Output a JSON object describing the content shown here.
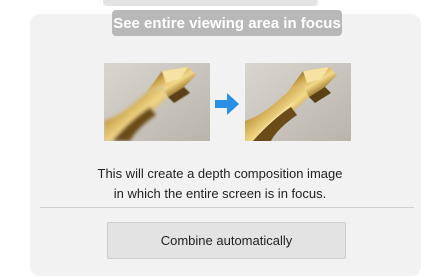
{
  "header": {
    "top_strip_text": "",
    "title": "See entire viewing area in focus"
  },
  "images": {
    "before": {
      "icon": "drill-bit-partially-focused-image",
      "blurred": true
    },
    "after": {
      "icon": "drill-bit-fully-focused-image",
      "blurred": false
    },
    "arrow": {
      "icon": "right-arrow-icon",
      "color": "#2b8fe6"
    }
  },
  "description": {
    "line1": "This will create a depth composition image",
    "line2": "in which the entire screen is in focus."
  },
  "actions": {
    "combine_label": "Combine automatically"
  },
  "colors": {
    "banner_bg": "#b8b8b8",
    "panel_bg": "#f2f2f2",
    "button_bg": "#e3e3e3",
    "arrow": "#2b8fe6"
  }
}
